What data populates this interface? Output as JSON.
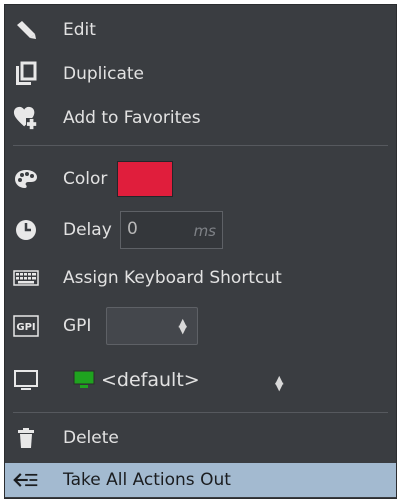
{
  "menu": {
    "edit_label": "Edit",
    "duplicate_label": "Duplicate",
    "favorites_label": "Add to Favorites",
    "color_label": "Color",
    "color_value": "#e01e3c",
    "delay_label": "Delay",
    "delay_value": "0",
    "delay_unit": "ms",
    "shortcut_label": "Assign Keyboard Shortcut",
    "gpi_label": "GPI",
    "gpi_value": "",
    "display_value": "<default>",
    "delete_label": "Delete",
    "take_out_label": "Take All Actions Out"
  },
  "icons": {
    "edit": "pencil-icon",
    "duplicate": "duplicate-icon",
    "favorites": "add-favorite-icon",
    "color": "palette-icon",
    "delay": "clock-icon",
    "shortcut": "keyboard-icon",
    "gpi": "gpi-icon",
    "display": "monitor-icon",
    "delete": "trash-icon",
    "take_out": "take-out-icon"
  },
  "colors": {
    "menu_bg": "#3a3d41",
    "text": "#e2e2e2",
    "highlight_bg": "#a3bad0",
    "monitor_green": "#1fa31f"
  }
}
